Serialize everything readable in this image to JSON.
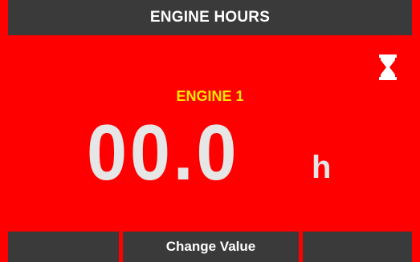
{
  "header": {
    "title": "ENGINE HOURS"
  },
  "status": {
    "timer_icon": "hourglass-icon"
  },
  "main": {
    "engine_label": "ENGINE 1",
    "value": "00.0",
    "unit": "h"
  },
  "softkeys": {
    "left_label": "",
    "center_label": "Change Value",
    "right_label": ""
  },
  "colors": {
    "background": "#ff0000",
    "bar": "#3a3a3a",
    "label": "#ffe600",
    "value": "#e6e6e6"
  }
}
